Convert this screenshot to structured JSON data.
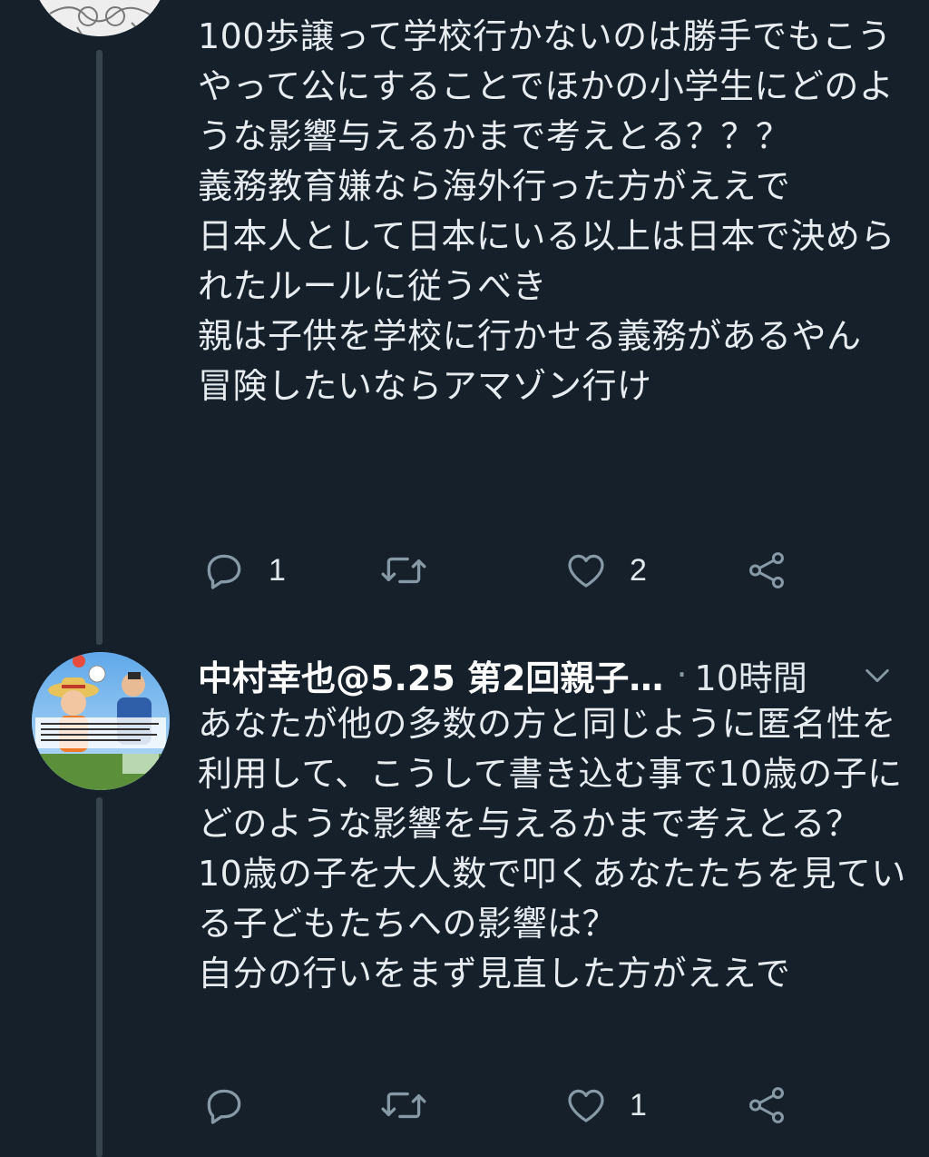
{
  "tweet_1": {
    "text": "100歩譲って学校行かないのは勝手でもこうやって公にすることでほかの小学生にどのような影響与えるかまで考えとる？？？\n義務教育嫌なら海外行った方がええで\n日本人として日本にいる以上は日本で決められたルールに従うべき\n親は子供を学校に行かせる義務があるやん\n冒険したいならアマゾン行け",
    "reply_count": "1",
    "retweet_count": "",
    "like_count": "2"
  },
  "tweet_2": {
    "display_name": "中村幸也@5.25 第2回親子…",
    "separator": "·",
    "time": "10時間",
    "text": "あなたが他の多数の方と同じように匿名性を利用して、こうして書き込む事で10歳の子にどのような影響を与えるかまで考えとる？\n10歳の子を大人数で叩くあなたたちを見ている子どもたちへの影響は？\n自分の行いをまず見直した方がええで",
    "reply_count": "",
    "retweet_count": "",
    "like_count": "1"
  },
  "colors": {
    "background": "#15202b",
    "thread_line": "#38444d",
    "icon_gray": "#8899a6",
    "text": "#e1e8ed"
  },
  "icons": [
    "reply-icon",
    "retweet-icon",
    "like-icon",
    "share-icon",
    "chevron-down-icon"
  ]
}
